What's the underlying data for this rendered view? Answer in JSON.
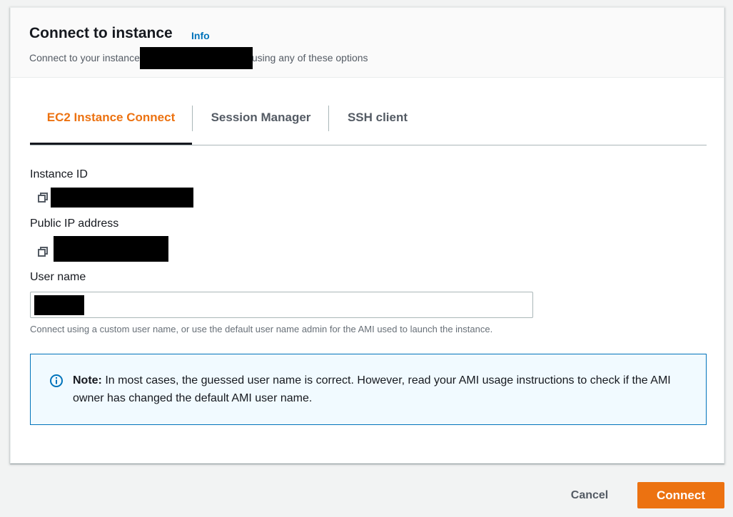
{
  "header": {
    "title": "Connect to instance",
    "info_link": "Info",
    "subtitle_before": "Connect to your instance",
    "subtitle_after": "using any of these options"
  },
  "tabs": [
    {
      "label": "EC2 Instance Connect",
      "active": true
    },
    {
      "label": "Session Manager",
      "active": false
    },
    {
      "label": "SSH client",
      "active": false
    }
  ],
  "fields": {
    "instance_id_label": "Instance ID",
    "public_ip_label": "Public IP address",
    "user_name_label": "User name",
    "user_name_hint": "Connect using a custom user name, or use the default user name admin for the AMI used to launch the instance."
  },
  "note": {
    "bold": "Note:",
    "text": "In most cases, the guessed user name is correct. However, read your AMI usage instructions to check if the AMI owner has changed the default AMI user name."
  },
  "footer": {
    "cancel_label": "Cancel",
    "connect_label": "Connect"
  },
  "colors": {
    "accent": "#ec7211",
    "link": "#0073bb",
    "note_background": "#f1faff"
  }
}
